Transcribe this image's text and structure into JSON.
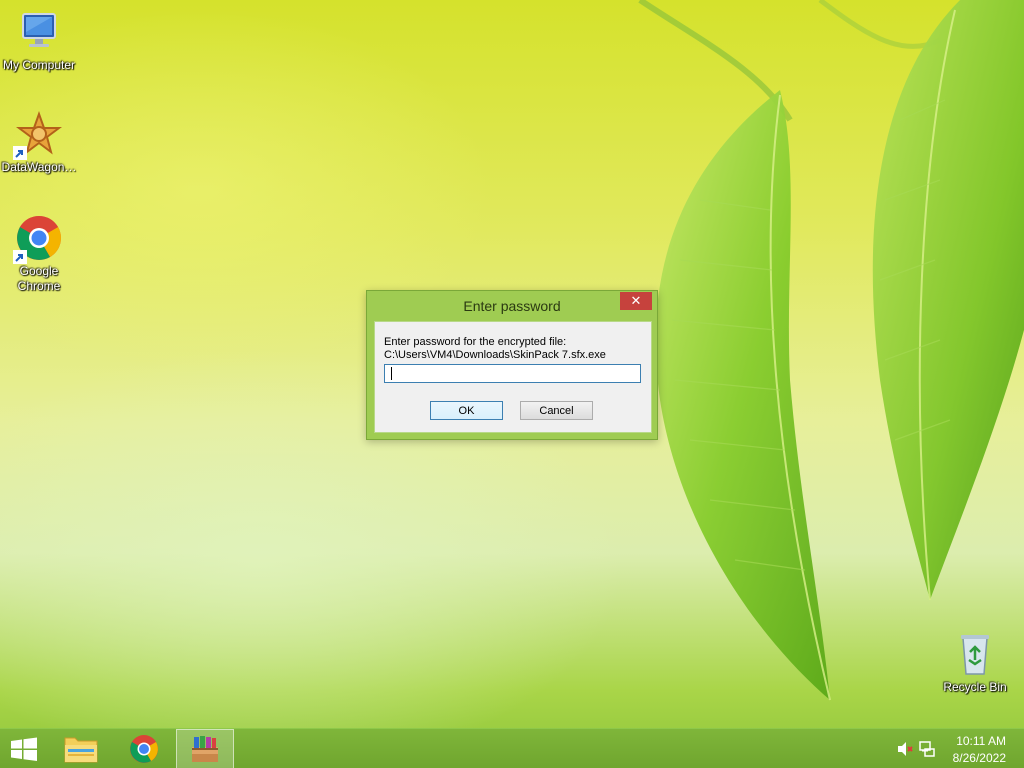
{
  "desktop": {
    "icons": [
      {
        "label": "My Computer",
        "icon": "computer-icon"
      },
      {
        "label": "DataWagon…",
        "icon": "datawagon-icon"
      },
      {
        "label": "Google Chrome",
        "icon": "chrome-icon"
      },
      {
        "label": "Recycle Bin",
        "icon": "recycle-bin-icon"
      }
    ]
  },
  "dialog": {
    "title": "Enter password",
    "close_symbol": "✕",
    "prompt": "Enter password for the encrypted file:",
    "path": "C:\\Users\\VM4\\Downloads\\SkinPack 7.sfx.exe",
    "password_value": "",
    "ok_label": "OK",
    "cancel_label": "Cancel"
  },
  "taskbar": {
    "pinned": [
      {
        "name": "start",
        "icon": "windows-logo-icon"
      },
      {
        "name": "file-explorer",
        "icon": "folder-icon"
      },
      {
        "name": "chrome",
        "icon": "chrome-icon"
      },
      {
        "name": "winrar",
        "icon": "winrar-icon",
        "active": true
      }
    ],
    "clock": {
      "time": "10:11 AM",
      "date": "8/26/2022"
    },
    "tray_icons": [
      "speaker-muted-icon",
      "network-icon"
    ]
  },
  "colors": {
    "taskbar": "#74ab33",
    "dialog_frame": "#9fcc52",
    "close_button": "#c6423d"
  }
}
